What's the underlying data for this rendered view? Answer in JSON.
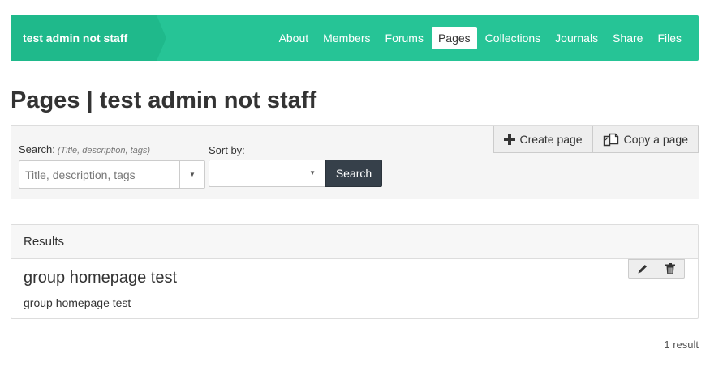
{
  "header": {
    "group_name": "test admin not staff",
    "tabs": [
      {
        "label": "About"
      },
      {
        "label": "Members"
      },
      {
        "label": "Forums"
      },
      {
        "label": "Pages"
      },
      {
        "label": "Collections"
      },
      {
        "label": "Journals"
      },
      {
        "label": "Share"
      },
      {
        "label": "Files"
      }
    ],
    "active_tab": "Pages"
  },
  "page": {
    "title": "Pages | test admin not staff"
  },
  "search": {
    "label": "Search:",
    "hint": "(Title, description, tags)",
    "placeholder": "Title, description, tags",
    "value": "",
    "sort_label": "Sort by:",
    "sort_value": "",
    "button_label": "Search"
  },
  "toolbar": {
    "create_label": "Create page",
    "copy_label": "Copy a page"
  },
  "results": {
    "heading": "Results",
    "items": [
      {
        "title": "group homepage test",
        "description": "group homepage test"
      }
    ],
    "count_text": "1 result"
  },
  "icons": {
    "create": "plus-icon",
    "copy": "copy-icon",
    "edit": "pencil-icon",
    "delete": "trash-icon",
    "dropdown": "caret-down-icon"
  },
  "colors": {
    "navbar": "#26c496",
    "navbar_title": "#1fb98b",
    "search_button": "#36404a"
  }
}
